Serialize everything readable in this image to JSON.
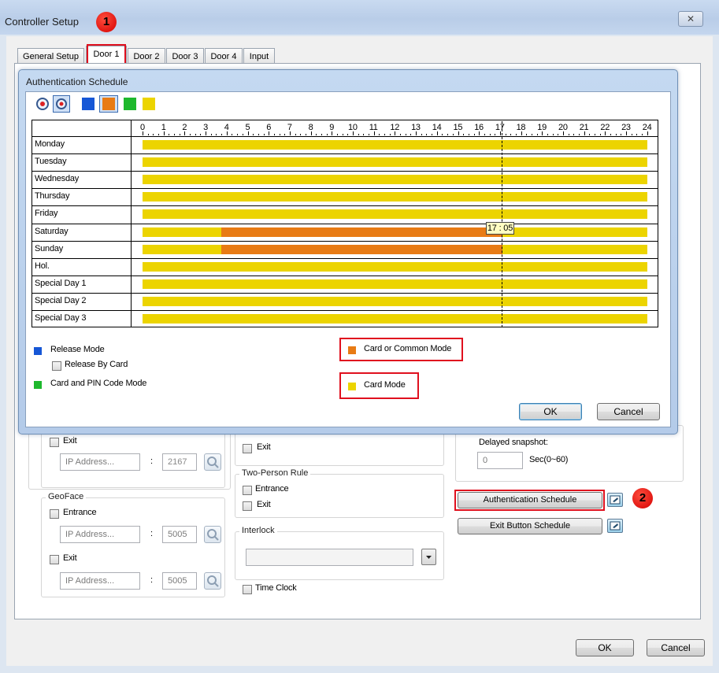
{
  "outer": {
    "title": "Controller Setup",
    "close_label": "✕",
    "tabs": [
      "General Setup",
      "Door 1",
      "Door 2",
      "Door 3",
      "Door 4",
      "Input"
    ],
    "exit_label": "Exit",
    "ip1_placeholder": "IP Address...",
    "port1": "2167",
    "geoface_title": "GeoFace",
    "entrance_label": "Entrance",
    "ip2_placeholder": "IP Address...",
    "port2": "5005",
    "exit2_label": "Exit",
    "ip3_placeholder": "IP Address...",
    "port3": "5005",
    "mid_exit_label": "Exit",
    "two_person_title": "Two-Person Rule",
    "tp_entrance_label": "Entrance",
    "tp_exit_label": "Exit",
    "interlock_title": "Interlock",
    "time_clock_label": "Time Clock",
    "delayed_snapshot_label": "Delayed snapshot:",
    "delayed_snapshot_value": "0",
    "delayed_snapshot_unit": "Sec(0~60)",
    "auth_schedule_button": "Authentication Schedule",
    "exit_button_schedule": "Exit Button Schedule",
    "colon1": ":",
    "colon2": ":",
    "colon3": ":",
    "ok_label": "OK",
    "cancel_label": "Cancel"
  },
  "inner": {
    "title": "Authentication Schedule",
    "hours": [
      "0",
      "1",
      "2",
      "3",
      "4",
      "5",
      "6",
      "7",
      "8",
      "9",
      "10",
      "11",
      "12",
      "13",
      "14",
      "15",
      "16",
      "17",
      "18",
      "19",
      "20",
      "21",
      "22",
      "23",
      "24"
    ],
    "days": [
      "Monday",
      "Tuesday",
      "Wednesday",
      "Thursday",
      "Friday",
      "Saturday",
      "Sunday",
      "Hol.",
      "Special Day 1",
      "Special Day 2",
      "Special Day 3"
    ],
    "current_time": "17 : 05",
    "legend": {
      "release_mode": "Release Mode",
      "release_by_card": "Release By Card",
      "card_pin_mode": "Card and PIN Code Mode",
      "card_or_common_mode": "Card or Common Mode",
      "card_mode": "Card Mode"
    },
    "ok_label": "OK",
    "cancel_label": "Cancel"
  },
  "schedule": [
    {
      "day": "Monday",
      "segments": [
        {
          "start": 0,
          "end": 24,
          "mode": "card"
        }
      ]
    },
    {
      "day": "Tuesday",
      "segments": [
        {
          "start": 0,
          "end": 24,
          "mode": "card"
        }
      ]
    },
    {
      "day": "Wednesday",
      "segments": [
        {
          "start": 0,
          "end": 24,
          "mode": "card"
        }
      ]
    },
    {
      "day": "Thursday",
      "segments": [
        {
          "start": 0,
          "end": 24,
          "mode": "card"
        }
      ]
    },
    {
      "day": "Friday",
      "segments": [
        {
          "start": 0,
          "end": 24,
          "mode": "card"
        }
      ]
    },
    {
      "day": "Saturday",
      "segments": [
        {
          "start": 0,
          "end": 3.75,
          "mode": "card"
        },
        {
          "start": 3.75,
          "end": 17.1,
          "mode": "card_or_common"
        },
        {
          "start": 17.1,
          "end": 24,
          "mode": "card"
        }
      ]
    },
    {
      "day": "Sunday",
      "segments": [
        {
          "start": 0,
          "end": 3.75,
          "mode": "card"
        },
        {
          "start": 3.75,
          "end": 17.1,
          "mode": "card_or_common"
        },
        {
          "start": 17.1,
          "end": 24,
          "mode": "card"
        }
      ]
    },
    {
      "day": "Hol.",
      "segments": [
        {
          "start": 0,
          "end": 24,
          "mode": "card"
        }
      ]
    },
    {
      "day": "Special Day 1",
      "segments": [
        {
          "start": 0,
          "end": 24,
          "mode": "card"
        }
      ]
    },
    {
      "day": "Special Day 2",
      "segments": [
        {
          "start": 0,
          "end": 24,
          "mode": "card"
        }
      ]
    },
    {
      "day": "Special Day 3",
      "segments": [
        {
          "start": 0,
          "end": 24,
          "mode": "card"
        }
      ]
    }
  ],
  "colors": {
    "release_mode": "#1657d6",
    "card_pin_mode": "#1eb82d",
    "card_or_common_mode": "#e87b14",
    "card_mode": "#ecd400",
    "highlight": "#e0101e"
  },
  "callouts": [
    "1",
    "2"
  ]
}
